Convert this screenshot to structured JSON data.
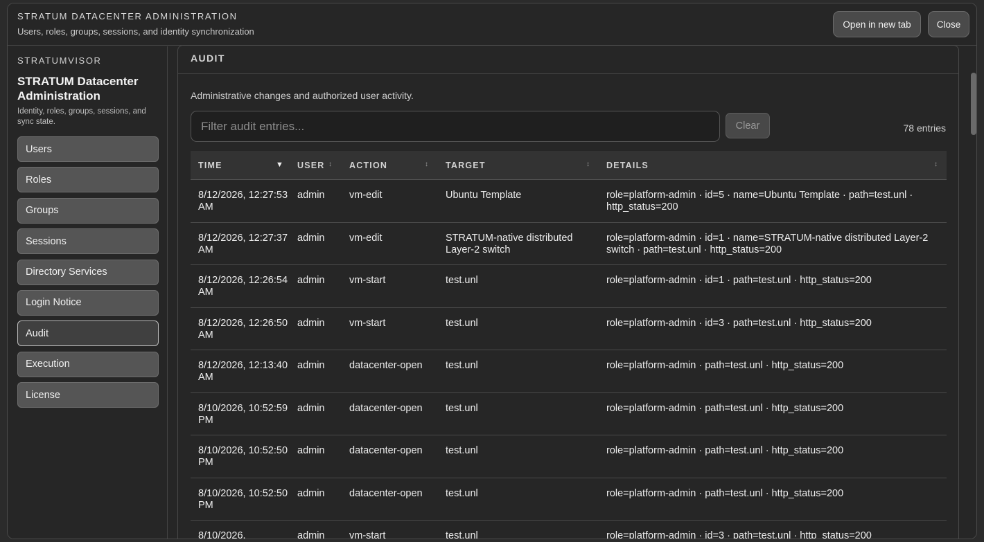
{
  "header": {
    "title": "STRATUM DATACENTER ADMINISTRATION",
    "subtitle": "Users, roles, groups, sessions, and identity synchronization",
    "open_tab_label": "Open in new tab",
    "close_label": "Close"
  },
  "sidebar": {
    "brand": "STRATUMVISOR",
    "title": "STRATUM Datacenter Administration",
    "description": "Identity, roles, groups, sessions, and sync state.",
    "items": [
      {
        "label": "Users"
      },
      {
        "label": "Roles"
      },
      {
        "label": "Groups"
      },
      {
        "label": "Sessions"
      },
      {
        "label": "Directory Services"
      },
      {
        "label": "Login Notice"
      },
      {
        "label": "Audit",
        "active": true
      },
      {
        "label": "Execution"
      },
      {
        "label": "License"
      }
    ]
  },
  "audit": {
    "title": "AUDIT",
    "description": "Administrative changes and authorized user activity.",
    "filter_placeholder": "Filter audit entries...",
    "filter_value": "",
    "clear_label": "Clear",
    "entries_count": "78 entries",
    "columns": [
      {
        "label": "TIME",
        "sort": "▼"
      },
      {
        "label": "USER",
        "sort": "↕"
      },
      {
        "label": "ACTION",
        "sort": "↕"
      },
      {
        "label": "TARGET",
        "sort": "↕"
      },
      {
        "label": "DETAILS",
        "sort": "↕"
      }
    ],
    "rows": [
      {
        "time": "8/12/2026, 12:27:53 AM",
        "user": "admin",
        "action": "vm-edit",
        "target": "Ubuntu Template",
        "details": "role=platform-admin · id=5 · name=Ubuntu Template · path=test.unl · http_status=200"
      },
      {
        "time": "8/12/2026, 12:27:37 AM",
        "user": "admin",
        "action": "vm-edit",
        "target": "STRATUM-native distributed Layer-2 switch",
        "details": "role=platform-admin · id=1 · name=STRATUM-native distributed Layer-2 switch · path=test.unl · http_status=200"
      },
      {
        "time": "8/12/2026, 12:26:54 AM",
        "user": "admin",
        "action": "vm-start",
        "target": "test.unl",
        "details": "role=platform-admin · id=1 · path=test.unl · http_status=200"
      },
      {
        "time": "8/12/2026, 12:26:50 AM",
        "user": "admin",
        "action": "vm-start",
        "target": "test.unl",
        "details": "role=platform-admin · id=3 · path=test.unl · http_status=200"
      },
      {
        "time": "8/12/2026, 12:13:40 AM",
        "user": "admin",
        "action": "datacenter-open",
        "target": "test.unl",
        "details": "role=platform-admin · path=test.unl · http_status=200"
      },
      {
        "time": "8/10/2026, 10:52:59 PM",
        "user": "admin",
        "action": "datacenter-open",
        "target": "test.unl",
        "details": "role=platform-admin · path=test.unl · http_status=200"
      },
      {
        "time": "8/10/2026, 10:52:50 PM",
        "user": "admin",
        "action": "datacenter-open",
        "target": "test.unl",
        "details": "role=platform-admin · path=test.unl · http_status=200"
      },
      {
        "time": "8/10/2026, 10:52:50 PM",
        "user": "admin",
        "action": "datacenter-open",
        "target": "test.unl",
        "details": "role=platform-admin · path=test.unl · http_status=200"
      },
      {
        "time": "8/10/2026,",
        "user": "admin",
        "action": "vm-start",
        "target": "test.unl",
        "details": "role=platform-admin · id=3 · path=test.unl · http_status=200"
      }
    ]
  }
}
